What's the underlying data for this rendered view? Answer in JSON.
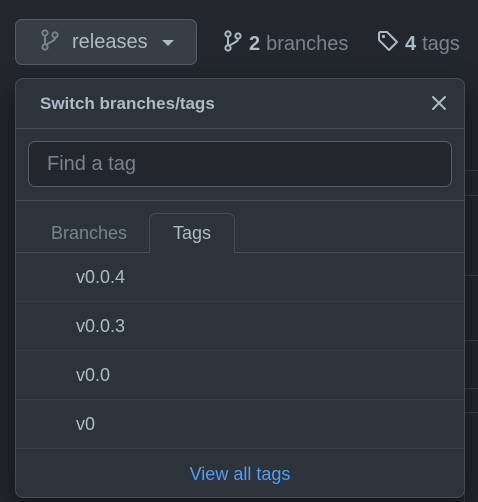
{
  "ref_selector": {
    "current_ref": "releases",
    "icon": "git-branch-icon"
  },
  "stats": {
    "branches_count": "2",
    "branches_label": "branches",
    "branches_icon": "git-branch-icon",
    "tags_count": "4",
    "tags_label": "tags",
    "tags_icon": "tag-icon"
  },
  "dropdown": {
    "title": "Switch branches/tags",
    "close_icon": "x-icon",
    "filter_placeholder": "Find a tag",
    "filter_value": "",
    "tabs": [
      {
        "label": "Branches",
        "selected": false
      },
      {
        "label": "Tags",
        "selected": true
      }
    ],
    "tags": [
      "v0.0.4",
      "v0.0.3",
      "v0.0",
      "v0"
    ],
    "footer_link": "View all tags"
  },
  "colors": {
    "background": "#22272e",
    "surface": "#2d333b",
    "border": "#444c56",
    "text": "#adbac7",
    "muted": "#768390",
    "link": "#539bf5"
  }
}
